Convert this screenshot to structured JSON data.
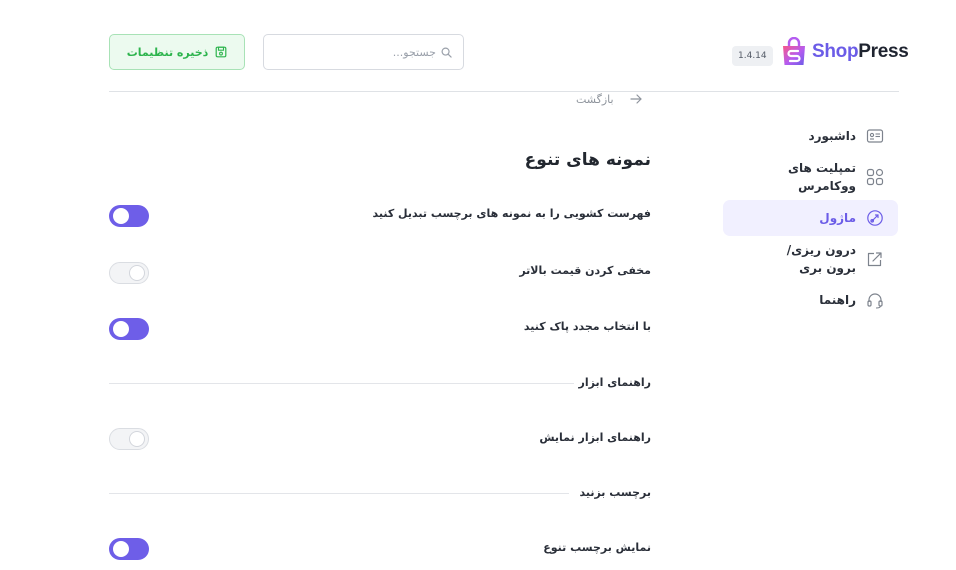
{
  "brand": {
    "shop": "Shop",
    "press": "Press",
    "version": "1.4.14"
  },
  "search": {
    "placeholder": "جستجو..."
  },
  "save_button": {
    "label": "ذخیره تنظیمات"
  },
  "back": {
    "label": "بازگشت"
  },
  "sidebar": {
    "items": [
      {
        "label": "داشبورد",
        "icon": "dashboard-icon",
        "active": false
      },
      {
        "label": "تمپلیت های ووکامرس",
        "icon": "templates-icon",
        "active": false
      },
      {
        "label": "ماژول",
        "icon": "module-icon",
        "active": true
      },
      {
        "label": "درون ریزی/برون بری",
        "icon": "import-export-icon",
        "active": false
      },
      {
        "label": "راهنما",
        "icon": "headset-icon",
        "active": false
      }
    ]
  },
  "main": {
    "title": "نمونه های تنوع",
    "settings": [
      {
        "label": "فهرست کشویی را به نمونه های برچسب تبدیل کنید",
        "enabled": true
      },
      {
        "label": "مخفی کردن قیمت بالاتر",
        "enabled": false
      },
      {
        "label": "با انتخاب مجدد پاک کنید",
        "enabled": true
      }
    ],
    "tooltip_group": {
      "title": "راهنمای ابزار",
      "settings": [
        {
          "label": "راهنمای ابزار نمایش",
          "enabled": false
        }
      ]
    },
    "badge_group": {
      "title": "برچسب بزنید",
      "settings": [
        {
          "label": "نمایش برچسب تنوع",
          "enabled": true
        }
      ]
    }
  },
  "colors": {
    "accent": "#6e5ee8",
    "save_green": "#2db44d",
    "save_bg": "#ecfaef",
    "active_bg": "#f1f0ff"
  }
}
